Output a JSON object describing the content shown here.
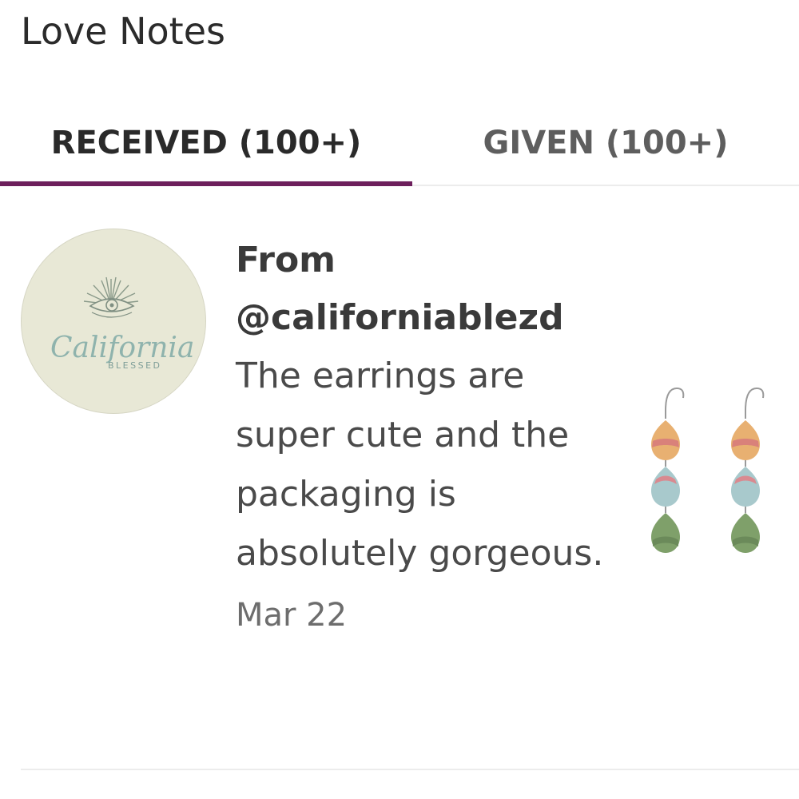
{
  "header": {
    "title": "Love Notes"
  },
  "tabs": [
    {
      "label": "RECEIVED (100+)",
      "active": true
    },
    {
      "label": "GIVEN (100+)",
      "active": false
    }
  ],
  "colors": {
    "accent": "#6d1f5c"
  },
  "note": {
    "from_prefix": "From",
    "sender": "@californiablezd",
    "message": "The earrings are super cute and the packaging is absolutely gorgeous.",
    "date": "Mar 22",
    "avatar": {
      "script_text": "California",
      "caption": "BLESSED"
    },
    "product_image": "earrings-thumbnail"
  }
}
